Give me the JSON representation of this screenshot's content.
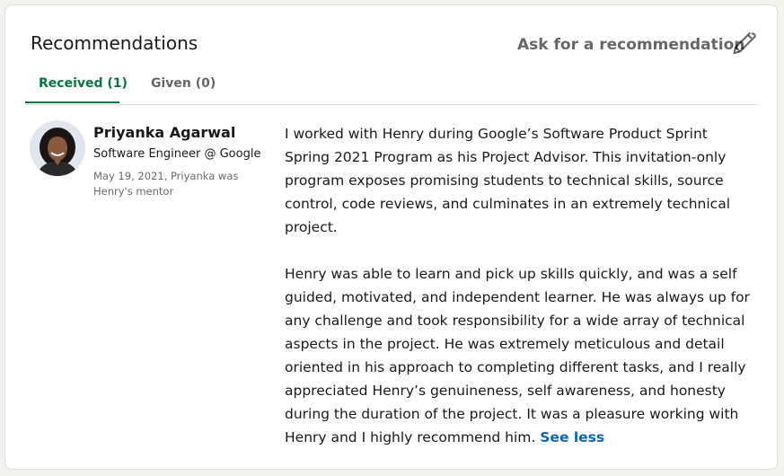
{
  "section": {
    "title": "Recommendations",
    "ask_label": "Ask for a recommendation",
    "edit_icon": "pencil-icon"
  },
  "tabs": [
    {
      "label": "Received (1)",
      "active": true
    },
    {
      "label": "Given (0)",
      "active": false
    }
  ],
  "recommendation": {
    "name": "Priyanka Agarwal",
    "headline": "Software Engineer @ Google",
    "meta": "May 19, 2021, Priyanka was Henry's mentor",
    "paragraphs": [
      "I worked with Henry during Google’s Software Product Sprint Spring 2021 Program as his Project Advisor. This invitation-only program exposes promising students to technical skills, source control, code reviews, and culminates in an extremely technical project.",
      "Henry was able to learn and pick up skills quickly, and was a self guided, motivated, and independent learner. He was always up for any challenge and took responsibility for a wide array of technical aspects in the project. He was extremely meticulous and detail oriented in his approach to completing different tasks, and I really appreciated Henry’s genuineness, self awareness, and honesty during the duration of the project. It was a pleasure working with Henry and I highly recommend him."
    ],
    "see_less_label": "See less"
  },
  "colors": {
    "accent_green": "#057642",
    "link_blue": "#0a66c2"
  }
}
